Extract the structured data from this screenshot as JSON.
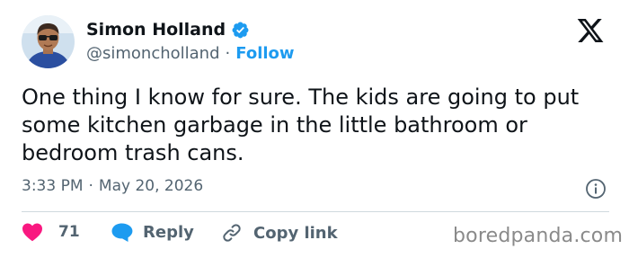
{
  "author": {
    "display_name": "Simon Holland",
    "handle": "@simoncholland",
    "separator": "·",
    "follow_label": "Follow",
    "verified_color": "#1d9bf0"
  },
  "tweet": {
    "text": "One thing I know for sure. The kids are going to put some kitchen garbage in the little bathroom or bedroom trash cans.",
    "time": "3:33 PM",
    "date": "May 20, 2026",
    "separator": "·"
  },
  "actions": {
    "like_count": "71",
    "reply_label": "Reply",
    "copy_link_label": "Copy link"
  },
  "icons": {
    "logo": "x-logo-icon",
    "verified": "verified-badge-icon",
    "info": "info-icon",
    "like": "heart-icon",
    "reply": "speech-bubble-icon",
    "copy_link": "link-icon"
  },
  "colors": {
    "like": "#f91880",
    "reply": "#1d9bf0",
    "link": "#1d9bf0",
    "text_secondary": "#536471"
  },
  "watermark": "boredpanda.com"
}
